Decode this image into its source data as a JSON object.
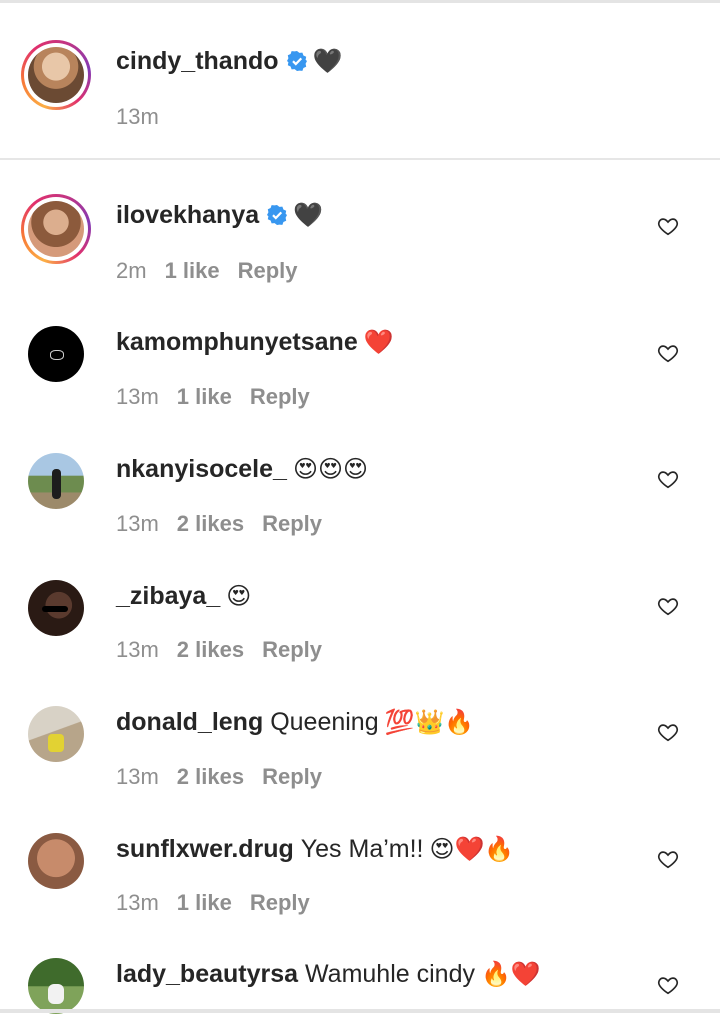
{
  "caption": {
    "username": "cindy_thando",
    "trailing": "🖤",
    "time": "13m"
  },
  "comments": [
    {
      "username": "ilovekhanya",
      "verified": true,
      "text": "",
      "emoji": "🖤",
      "time": "2m",
      "likes": "1 like",
      "reply": "Reply"
    },
    {
      "username": "kamomphunyetsane",
      "verified": false,
      "text": "",
      "emoji": "❤️",
      "time": "13m",
      "likes": "1 like",
      "reply": "Reply"
    },
    {
      "username": "nkanyisocele_",
      "verified": false,
      "text": "",
      "emoji": "😍😍😍",
      "time": "13m",
      "likes": "2 likes",
      "reply": "Reply"
    },
    {
      "username": "_zibaya_",
      "verified": false,
      "text": "",
      "emoji": "😍",
      "time": "13m",
      "likes": "2 likes",
      "reply": "Reply"
    },
    {
      "username": "donald_leng",
      "verified": false,
      "text": "Queening",
      "emoji": "💯👑🔥",
      "time": "13m",
      "likes": "2 likes",
      "reply": "Reply"
    },
    {
      "username": "sunflxwer.drug",
      "verified": false,
      "text": "Yes Ma’m!!",
      "emoji": "😍❤️🔥",
      "time": "13m",
      "likes": "1 like",
      "reply": "Reply"
    },
    {
      "username": "lady_beautyrsa",
      "verified": false,
      "text": "Wamuhle cindy",
      "emoji": "🔥❤️",
      "time": "",
      "likes": "",
      "reply": ""
    }
  ],
  "colors": {
    "verified": "#3897f0",
    "meta": "#8e8e8e",
    "text": "#262626"
  }
}
